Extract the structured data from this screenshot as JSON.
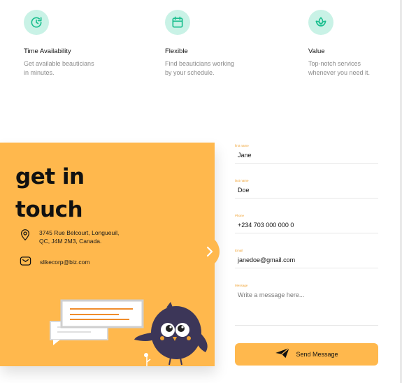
{
  "features": [
    {
      "icon": "clock-refresh-icon",
      "title": "Time Availability",
      "desc_line1": "Get available beauticians",
      "desc_line2": "in minutes."
    },
    {
      "icon": "calendar-icon",
      "title": "Flexible",
      "desc_line1": "Find beauticians working",
      "desc_line2": "by your schedule."
    },
    {
      "icon": "lotus-leaf-icon",
      "title": "Value",
      "desc_line1": "Top-notch services",
      "desc_line2": "whenever you need it."
    }
  ],
  "contact": {
    "headline_line1": "get in",
    "headline_line2": "touch",
    "address_line1": "3745 Rue Belcourt, Longueuil,",
    "address_line2": "QC, J4M 2M3, Canada.",
    "email": "slikecorp@biz.com"
  },
  "form": {
    "first_name": {
      "label": "first name",
      "value": "Jane"
    },
    "last_name": {
      "label": "last name",
      "value": "Doe"
    },
    "phone": {
      "label": "Phone",
      "value": "+234 703 000 000 0"
    },
    "email": {
      "label": "Email",
      "value": "janedoe@gmail.com"
    },
    "message": {
      "label": "Message",
      "placeholder": "Write a message here..."
    },
    "send_label": "Send Message"
  },
  "colors": {
    "accent": "#ffb84d",
    "icon_bg": "#c9f2e6",
    "icon_fg": "#1bbf8f",
    "label": "#f0a232"
  }
}
